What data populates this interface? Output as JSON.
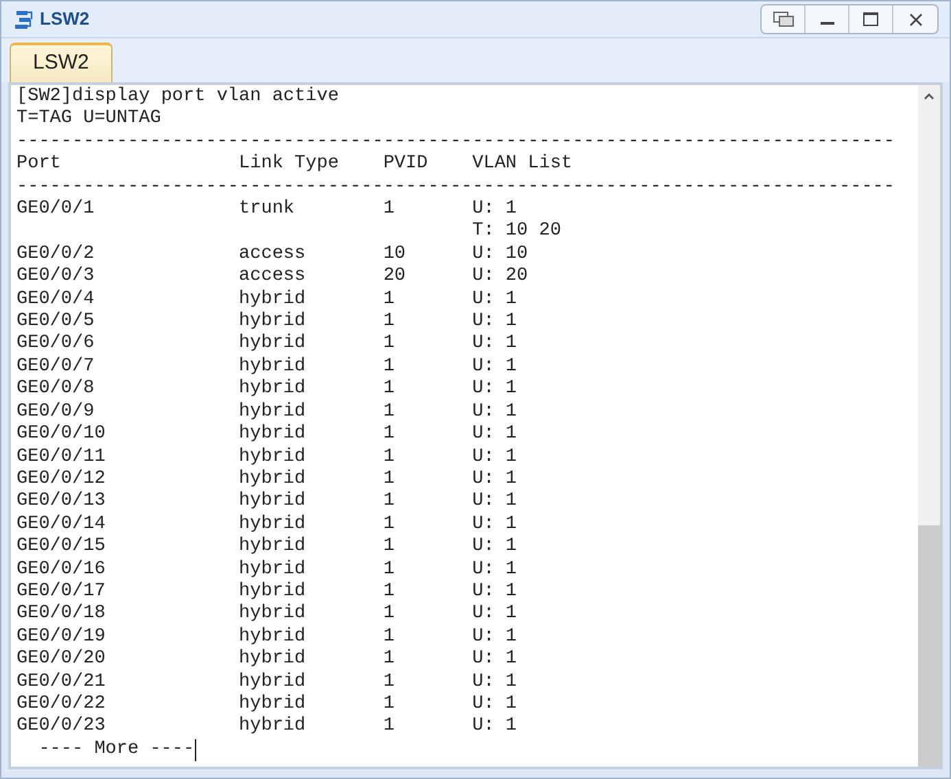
{
  "window": {
    "title": "LSW2"
  },
  "tabs": [
    {
      "label": "LSW2",
      "selected": true
    }
  ],
  "terminal": {
    "lines": [
      "[SW2]display port vlan active",
      "T=TAG U=UNTAG"
    ],
    "rule_top": "-------------------------------------------------------------------------------",
    "columns": [
      "Port",
      "Link Type",
      "PVID",
      "VLAN List"
    ],
    "rule_bottom": "-------------------------------------------------------------------------------",
    "rows": [
      {
        "port": "GE0/0/1",
        "link_type": "trunk",
        "pvid": "1",
        "vlan_list": [
          "U: 1",
          "T: 10 20"
        ]
      },
      {
        "port": "GE0/0/2",
        "link_type": "access",
        "pvid": "10",
        "vlan_list": [
          "U: 10"
        ]
      },
      {
        "port": "GE0/0/3",
        "link_type": "access",
        "pvid": "20",
        "vlan_list": [
          "U: 20"
        ]
      },
      {
        "port": "GE0/0/4",
        "link_type": "hybrid",
        "pvid": "1",
        "vlan_list": [
          "U: 1"
        ]
      },
      {
        "port": "GE0/0/5",
        "link_type": "hybrid",
        "pvid": "1",
        "vlan_list": [
          "U: 1"
        ]
      },
      {
        "port": "GE0/0/6",
        "link_type": "hybrid",
        "pvid": "1",
        "vlan_list": [
          "U: 1"
        ]
      },
      {
        "port": "GE0/0/7",
        "link_type": "hybrid",
        "pvid": "1",
        "vlan_list": [
          "U: 1"
        ]
      },
      {
        "port": "GE0/0/8",
        "link_type": "hybrid",
        "pvid": "1",
        "vlan_list": [
          "U: 1"
        ]
      },
      {
        "port": "GE0/0/9",
        "link_type": "hybrid",
        "pvid": "1",
        "vlan_list": [
          "U: 1"
        ]
      },
      {
        "port": "GE0/0/10",
        "link_type": "hybrid",
        "pvid": "1",
        "vlan_list": [
          "U: 1"
        ]
      },
      {
        "port": "GE0/0/11",
        "link_type": "hybrid",
        "pvid": "1",
        "vlan_list": [
          "U: 1"
        ]
      },
      {
        "port": "GE0/0/12",
        "link_type": "hybrid",
        "pvid": "1",
        "vlan_list": [
          "U: 1"
        ]
      },
      {
        "port": "GE0/0/13",
        "link_type": "hybrid",
        "pvid": "1",
        "vlan_list": [
          "U: 1"
        ]
      },
      {
        "port": "GE0/0/14",
        "link_type": "hybrid",
        "pvid": "1",
        "vlan_list": [
          "U: 1"
        ]
      },
      {
        "port": "GE0/0/15",
        "link_type": "hybrid",
        "pvid": "1",
        "vlan_list": [
          "U: 1"
        ]
      },
      {
        "port": "GE0/0/16",
        "link_type": "hybrid",
        "pvid": "1",
        "vlan_list": [
          "U: 1"
        ]
      },
      {
        "port": "GE0/0/17",
        "link_type": "hybrid",
        "pvid": "1",
        "vlan_list": [
          "U: 1"
        ]
      },
      {
        "port": "GE0/0/18",
        "link_type": "hybrid",
        "pvid": "1",
        "vlan_list": [
          "U: 1"
        ]
      },
      {
        "port": "GE0/0/19",
        "link_type": "hybrid",
        "pvid": "1",
        "vlan_list": [
          "U: 1"
        ]
      },
      {
        "port": "GE0/0/20",
        "link_type": "hybrid",
        "pvid": "1",
        "vlan_list": [
          "U: 1"
        ]
      },
      {
        "port": "GE0/0/21",
        "link_type": "hybrid",
        "pvid": "1",
        "vlan_list": [
          "U: 1"
        ]
      },
      {
        "port": "GE0/0/22",
        "link_type": "hybrid",
        "pvid": "1",
        "vlan_list": [
          "U: 1"
        ]
      },
      {
        "port": "GE0/0/23",
        "link_type": "hybrid",
        "pvid": "1",
        "vlan_list": [
          "U: 1"
        ]
      }
    ],
    "more": "---- More ----"
  }
}
